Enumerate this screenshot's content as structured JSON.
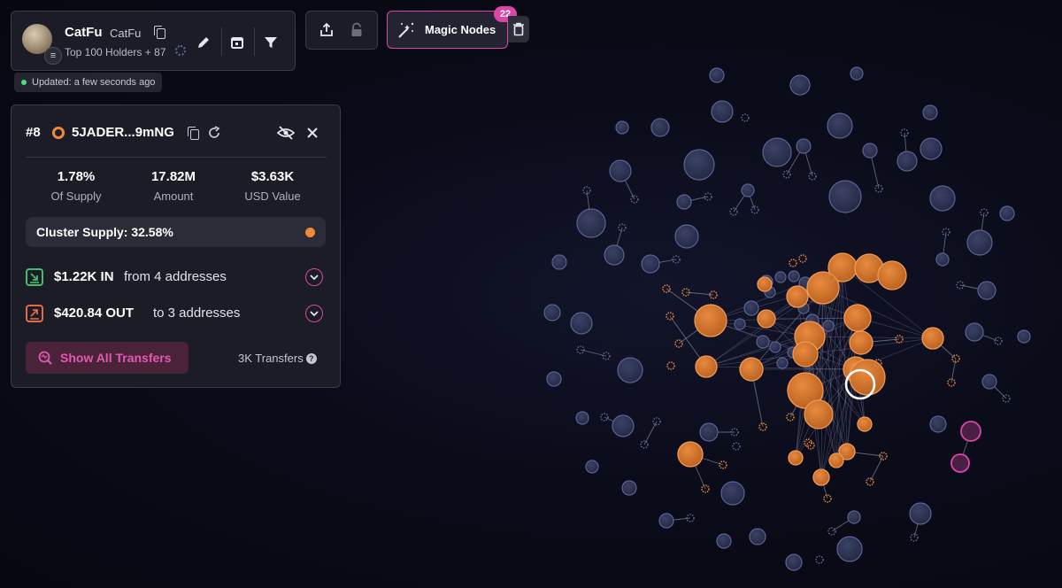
{
  "token": {
    "name": "CatFu",
    "ticker": "CatFu",
    "subtitle": "Top 100 Holders + 87",
    "updated": "Updated: a few seconds ago"
  },
  "toolbar": {
    "icons": [
      "pencil-icon",
      "calendar-icon",
      "filter-icon",
      "share-icon",
      "lock-icon",
      "trash-icon"
    ]
  },
  "magic_nodes": {
    "label": "Magic Nodes",
    "count": "22"
  },
  "holder": {
    "rank": "#8",
    "address": "5JADER...9mNG",
    "stats": [
      {
        "value": "1.78%",
        "label": "Of Supply"
      },
      {
        "value": "17.82M",
        "label": "Amount"
      },
      {
        "value": "$3.63K",
        "label": "USD Value"
      }
    ],
    "cluster_supply": "Cluster Supply: 32.58%",
    "inflow": {
      "amount": "$1.22K IN",
      "desc": "from 4 addresses"
    },
    "outflow": {
      "amount": "$420.84 OUT",
      "desc": "to 3 addresses"
    },
    "show_transfers": "Show All Transfers",
    "transfers_count": "3K Transfers"
  },
  "colors": {
    "accent": "#d946a8",
    "cluster": "#f08a36",
    "node": "#2e3454",
    "node_stroke": "#5a6394"
  }
}
